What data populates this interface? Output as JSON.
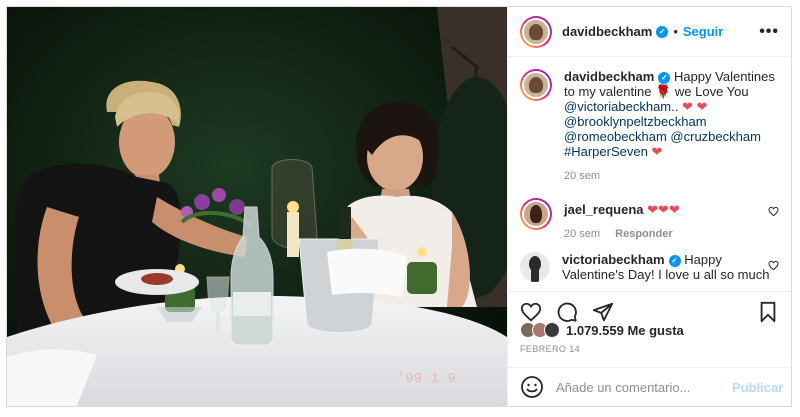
{
  "post": {
    "author": "davidbeckham",
    "follow_label": "Seguir",
    "separator": "•",
    "more_label": "•••",
    "verified_mark": "✓",
    "photo_watermark": "'99 1 9"
  },
  "caption": {
    "username": "davidbeckham",
    "text_1": "Happy Valentines to my valentine",
    "rose": "🌹",
    "text_2": "we Love You",
    "mention_1": "@victoriabeckham..",
    "hearts_1": "❤ ❤",
    "mention_2": "@brooklynpeltzbeckham",
    "mention_3": "@romeobeckham",
    "mention_4": "@cruzbeckham",
    "hashtag": "#HarperSeven",
    "heart_end": "❤",
    "time": "20 sem"
  },
  "comments": [
    {
      "username": "jael_requena",
      "text": "❤❤❤",
      "time": "20 sem",
      "reply_label": "Responder",
      "like_icon": "heart-outline-icon"
    },
    {
      "username": "victoriabeckham",
      "text": "Happy Valentine's Day! I love u all so much",
      "like_icon": "heart-outline-icon"
    }
  ],
  "actions": {
    "likes": "1.079.559 Me gusta",
    "date": "FEBRERO 14",
    "icons": [
      "heart-outline-icon",
      "comment-icon",
      "share-icon",
      "bookmark-icon"
    ]
  },
  "composer": {
    "placeholder": "Añade un comentario...",
    "publish_label": "Publicar",
    "emoji_icon": "smiley-icon"
  },
  "colors": {
    "accent": "#0095f6",
    "heart": "#ed4956",
    "muted": "#8e8e8e",
    "publish_disabled": "#b3dbff"
  }
}
